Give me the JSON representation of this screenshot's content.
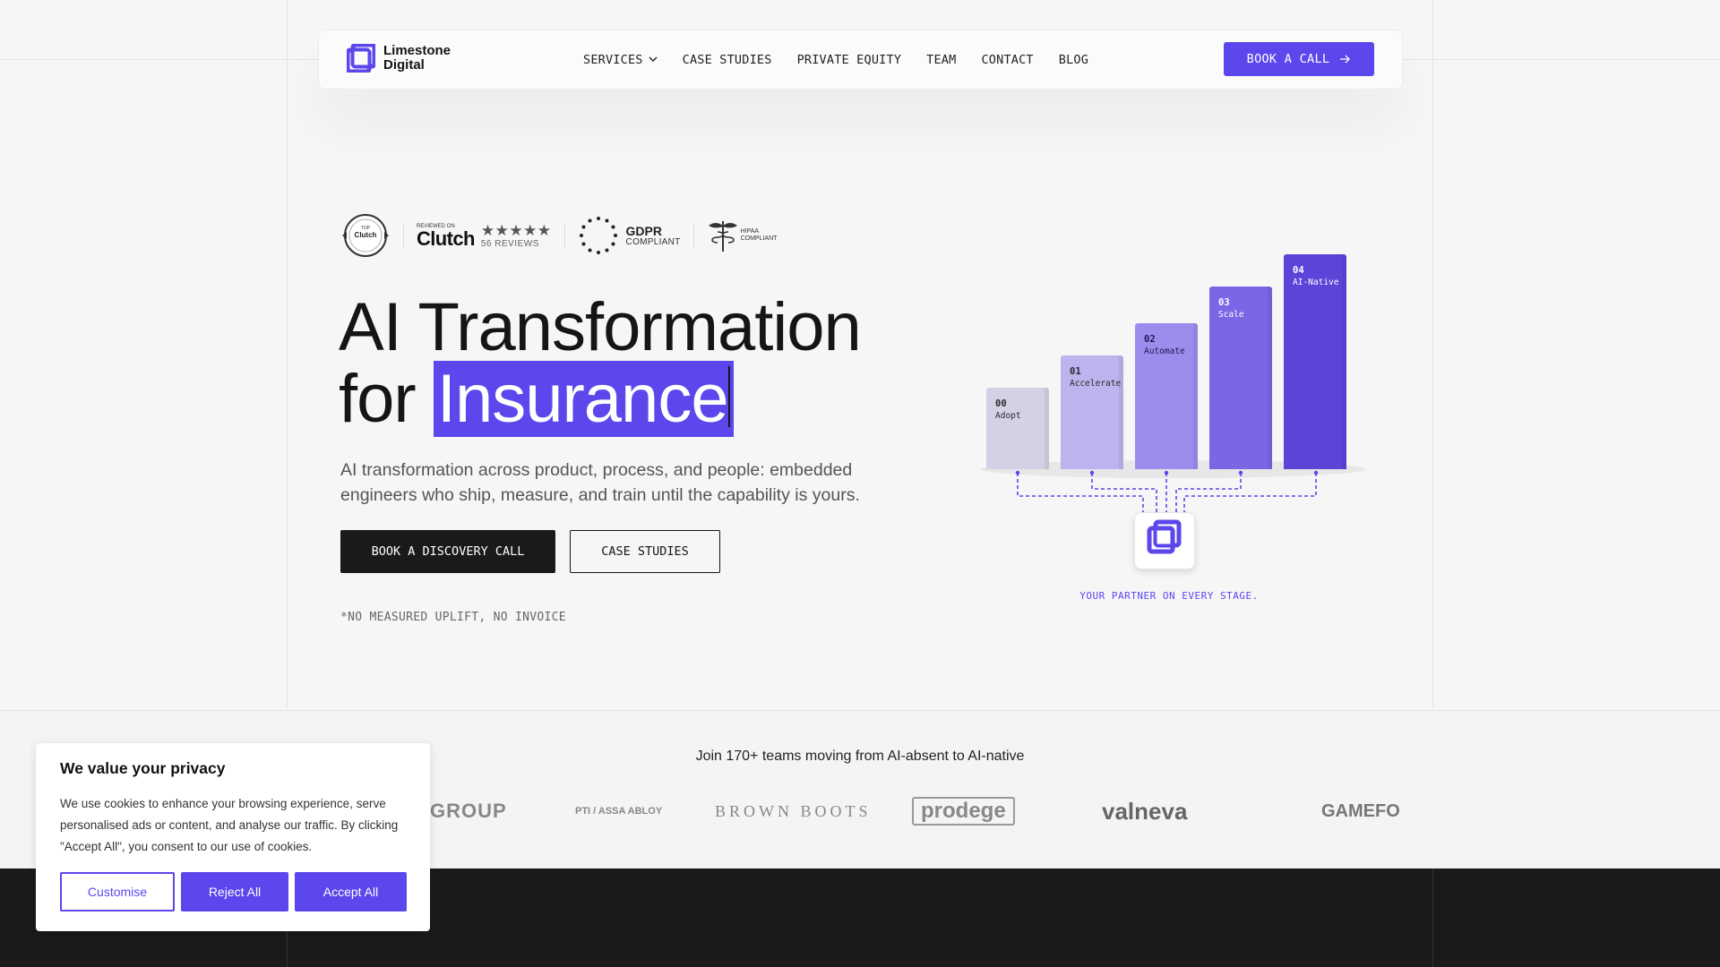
{
  "nav": {
    "logo_line1": "Limestone",
    "logo_line2": "Digital",
    "links": [
      "SERVICES",
      "CASE STUDIES",
      "PRIVATE EQUITY",
      "TEAM",
      "CONTACT",
      "BLOG"
    ],
    "cta": "BOOK A CALL"
  },
  "badges": {
    "clutch_reviewed_on": "REVIEWED ON",
    "clutch_name": "Clutch",
    "clutch_stars": "★★★★★",
    "clutch_reviews": "56 REVIEWS",
    "gdpr_title": "GDPR",
    "gdpr_sub": "COMPLIANT",
    "hipaa_line1": "HIPAA",
    "hipaa_line2": "COMPLIANT",
    "seal_line1": "TOP",
    "seal_line2": "Clutch"
  },
  "hero": {
    "title_line1": "AI Transformation",
    "title_for": "for",
    "title_highlight": "Insurance",
    "subtitle": "AI transformation across product, process, and people: embedded engineers who ship, measure, and train until the capability is yours.",
    "primary_cta": "BOOK A DISCOVERY CALL",
    "secondary_cta": "CASE STUDIES",
    "footnote": "*NO MEASURED UPLIFT, NO INVOICE"
  },
  "stages": [
    {
      "num": "00",
      "label": "Adopt",
      "level": 0.38,
      "color": "#d4d1e4",
      "text": "#2a2a2a"
    },
    {
      "num": "01",
      "label": "Accelerate",
      "level": 0.53,
      "color": "#bdb3ee",
      "text": "#2a2a2a"
    },
    {
      "num": "02",
      "label": "Automate",
      "level": 0.68,
      "color": "#9d8cec",
      "text": "#1e1850"
    },
    {
      "num": "03",
      "label": "Scale",
      "level": 0.85,
      "color": "#7b66e6",
      "text": "#ffffff"
    },
    {
      "num": "04",
      "label": "AI-Native",
      "level": 1.0,
      "color": "#5b45d8",
      "text": "#ffffff"
    }
  ],
  "partner_caption": "YOUR PARTNER ON EVERY STAGE.",
  "clients": {
    "heading": "Join 170+ teams moving from AI-absent to AI-native",
    "logos": [
      "GROUP",
      "PTI / ASSA ABLOY",
      "BROWN BOOTS",
      "prodege",
      "valneva",
      "GAMEFO"
    ]
  },
  "cookie": {
    "title": "We value your privacy",
    "body": "We use cookies to enhance your browsing experience, serve personalised ads or content, and analyse our traffic. By clicking \"Accept All\", you consent to our use of cookies.",
    "customise": "Customise",
    "reject": "Reject All",
    "accept": "Accept All"
  },
  "colors": {
    "accent": "#5b47ec",
    "dark": "#1a1a1a",
    "background": "#f6f6f6"
  }
}
